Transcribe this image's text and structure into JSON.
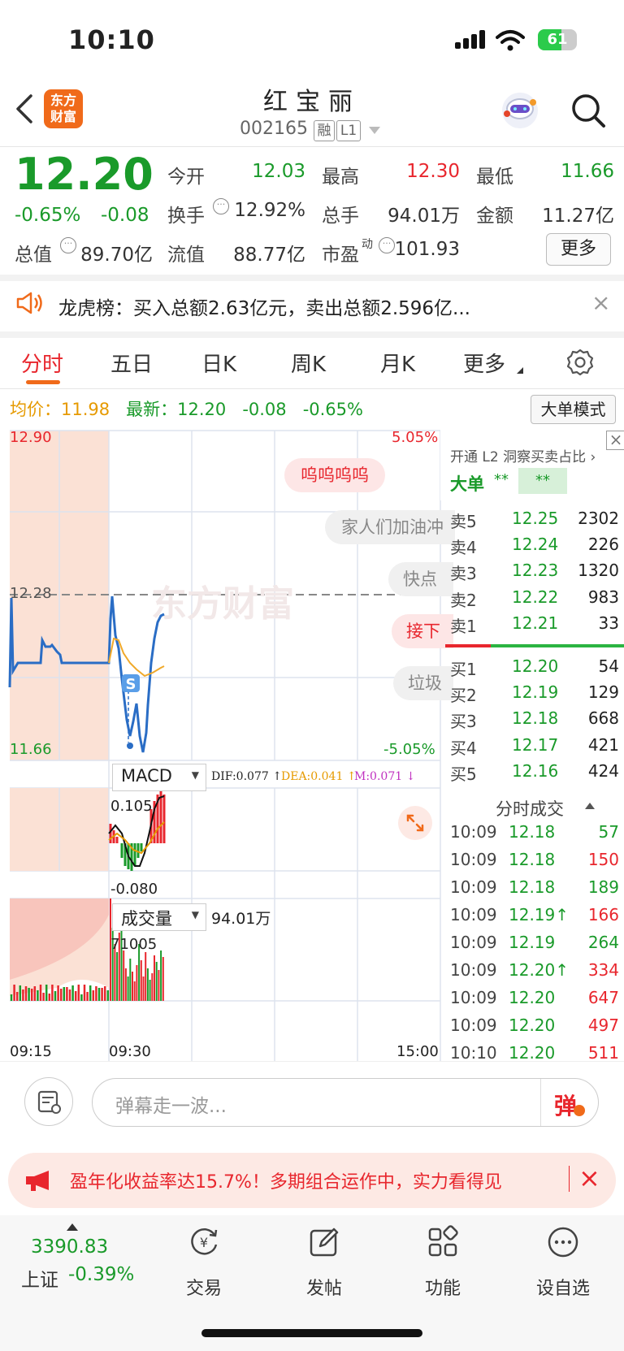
{
  "status": {
    "time": "10:10",
    "battery": "61"
  },
  "header": {
    "logo": "东方\n财富",
    "title": "红宝丽",
    "code": "002165",
    "tag_margin": "融",
    "tag_level": "L1"
  },
  "quote": {
    "price": "12.20",
    "change_pct": "-0.65%",
    "change": "-0.08",
    "open_label": "今开",
    "open": "12.03",
    "high_label": "最高",
    "high": "12.30",
    "low_label": "最低",
    "low": "11.66",
    "turnover_label": "换手",
    "turnover": "12.92%",
    "volume_label": "总手",
    "volume": "94.01万",
    "amount_label": "金额",
    "amount": "11.27亿",
    "mktcap_label": "总值",
    "mktcap": "89.70亿",
    "float_label": "流值",
    "float": "88.77亿",
    "pe_label": "市盈",
    "pe_sup": "动",
    "pe": "101.93",
    "more": "更多"
  },
  "dragon": {
    "text": "龙虎榜：买入总额2.63亿元，卖出总额2.596亿..."
  },
  "tabs": [
    "分时",
    "五日",
    "日K",
    "周K",
    "月K",
    "更多"
  ],
  "chart": {
    "avg_label": "均价：",
    "avg": "11.98",
    "latest_label": "最新：",
    "latest": "12.20",
    "latest_change": "-0.08",
    "latest_pct": "-0.65%",
    "big_order_btn": "大单模式",
    "y_top": "12.90",
    "y_ref": "12.28",
    "y_bottom": "11.66",
    "pct_top": "5.05%",
    "pct_bottom": "-5.05%",
    "watermark": "东方财富",
    "danmaku": [
      "呜呜呜呜",
      "家人们加油冲",
      "快点",
      "接下",
      "垃圾"
    ],
    "s_marker": "S",
    "macd_label": "MACD",
    "dif": "DIF:0.077",
    "dea": "DEA:0.041",
    "m": "M:0.071",
    "macd_top": "0.105",
    "macd_bottom": "-0.080",
    "vol_label": "成交量",
    "vol_total": "94.01万",
    "vol_max": "71005",
    "time_start": "09:15",
    "time_mid": "09:30",
    "time_end": "15:00"
  },
  "orderbook": {
    "promo": "开通 L2 洞察买卖占比 ›",
    "big_label": "大单",
    "big_v1": "**",
    "big_v2": "**",
    "asks": [
      {
        "label": "卖5",
        "price": "12.25",
        "vol": "2302"
      },
      {
        "label": "卖4",
        "price": "12.24",
        "vol": "226"
      },
      {
        "label": "卖3",
        "price": "12.23",
        "vol": "1320"
      },
      {
        "label": "卖2",
        "price": "12.22",
        "vol": "983"
      },
      {
        "label": "卖1",
        "price": "12.21",
        "vol": "33"
      }
    ],
    "bids": [
      {
        "label": "买1",
        "price": "12.20",
        "vol": "54"
      },
      {
        "label": "买2",
        "price": "12.19",
        "vol": "129"
      },
      {
        "label": "买3",
        "price": "12.18",
        "vol": "668"
      },
      {
        "label": "买4",
        "price": "12.17",
        "vol": "421"
      },
      {
        "label": "买5",
        "price": "12.16",
        "vol": "424"
      }
    ],
    "trades_title": "分时成交",
    "trades": [
      {
        "time": "10:09",
        "price": "12.18",
        "vol": "57",
        "color": "#1a9a2a"
      },
      {
        "time": "10:09",
        "price": "12.18",
        "vol": "150",
        "color": "#e8262d"
      },
      {
        "time": "10:09",
        "price": "12.18",
        "vol": "189",
        "color": "#1a9a2a"
      },
      {
        "time": "10:09",
        "price": "12.19↑",
        "vol": "166",
        "color": "#e8262d"
      },
      {
        "time": "10:09",
        "price": "12.19",
        "vol": "264",
        "color": "#1a9a2a"
      },
      {
        "time": "10:09",
        "price": "12.20↑",
        "vol": "334",
        "color": "#e8262d"
      },
      {
        "time": "10:09",
        "price": "12.20",
        "vol": "647",
        "color": "#e8262d"
      },
      {
        "time": "10:09",
        "price": "12.20",
        "vol": "497",
        "color": "#e8262d"
      },
      {
        "time": "10:10",
        "price": "12.20",
        "vol": "511",
        "color": "#e8262d"
      }
    ]
  },
  "comment": {
    "placeholder": "弹幕走一波...",
    "danmaku_btn": "弹"
  },
  "ad": {
    "text": "盈年化收益率达15.7%！多期组合运作中，实力看得见"
  },
  "nav": {
    "index_value": "3390.83",
    "index_name": "上证",
    "index_pct": "-0.39%",
    "items": [
      "交易",
      "发帖",
      "功能",
      "设自选"
    ]
  },
  "colors": {
    "up": "#e8262d",
    "down": "#1a9a2a",
    "accent": "#f06a1a"
  }
}
